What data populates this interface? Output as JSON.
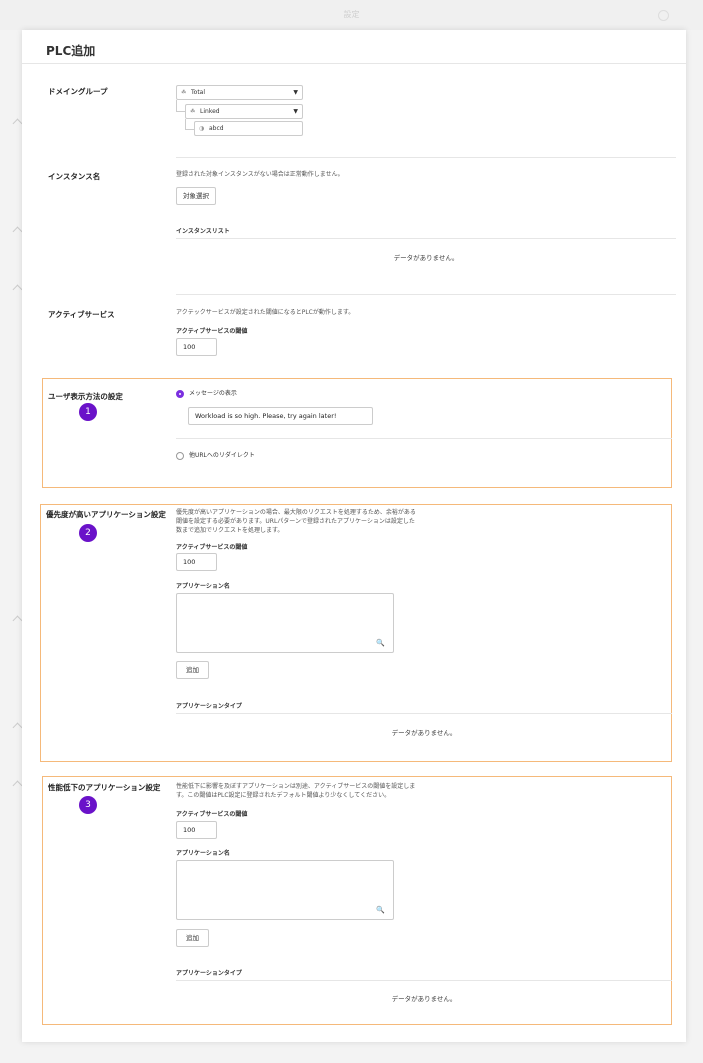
{
  "window": {
    "title": "設定"
  },
  "panel": {
    "title": "PLC追加"
  },
  "domain_group": {
    "label": "ドメイングループ",
    "selects": [
      "Total",
      "Linked"
    ],
    "leaf": "abcd"
  },
  "instance": {
    "label": "インスタンス名",
    "note": "登録された対象インスタンスがない場合は正常動作しません。",
    "select_button": "対象選択",
    "list_title": "インスタンスリスト",
    "empty": "データがありません。"
  },
  "active_service": {
    "label": "アクティブサービス",
    "note": "アクテックサービスが設定された閾値になるとPLCが動作します。",
    "threshold_label": "アクティブサービスの閾値",
    "threshold_value": "100"
  },
  "user_display": {
    "label": "ユーザ表示方法の設定",
    "badge": "1",
    "option_message": "メッセージの表示",
    "message_value": "Workload is so high. Please, try again later!",
    "option_redirect": "他URLへのリダイレクト"
  },
  "high_priority": {
    "label": "優先度が高いアプリケーション設定",
    "badge": "2",
    "note_lines": [
      "優先度が高いアプリケーションの場合、最大限のリクエストを処理するため、余裕がある",
      "閾値を設定する必要があります。URLパターンで登録されたアプリケーションは設定した",
      "数まで追加でリクエストを処理します。"
    ],
    "threshold_label": "アクティブサービスの閾値",
    "threshold_value": "100",
    "app_name_label": "アプリケーション名",
    "add_button": "追加",
    "app_type_label": "アプリケーションタイプ",
    "empty": "データがありません。"
  },
  "degraded": {
    "label": "性能低下のアプリケーション設定",
    "badge": "3",
    "note_lines": [
      "性能低下に影響を及ぼすアプリケーションは別途、アクティブサービスの閾値を設定しま",
      "す。この閾値はPLC設定に登録されたデフォルト閾値より少なくしてください。"
    ],
    "threshold_label": "アクティブサービスの閾値",
    "threshold_value": "100",
    "app_name_label": "アプリケーション名",
    "add_button": "追加",
    "app_type_label": "アプリケーションタイプ",
    "empty": "データがありません。"
  },
  "colors": {
    "accent": "#6a12c9",
    "highlight_border": "#f5b97a",
    "radio_on": "#7b2fe0"
  },
  "icons": {
    "select": "sitemap-icon",
    "search": "magnifier-icon",
    "dropdown": "caret-down-icon"
  }
}
